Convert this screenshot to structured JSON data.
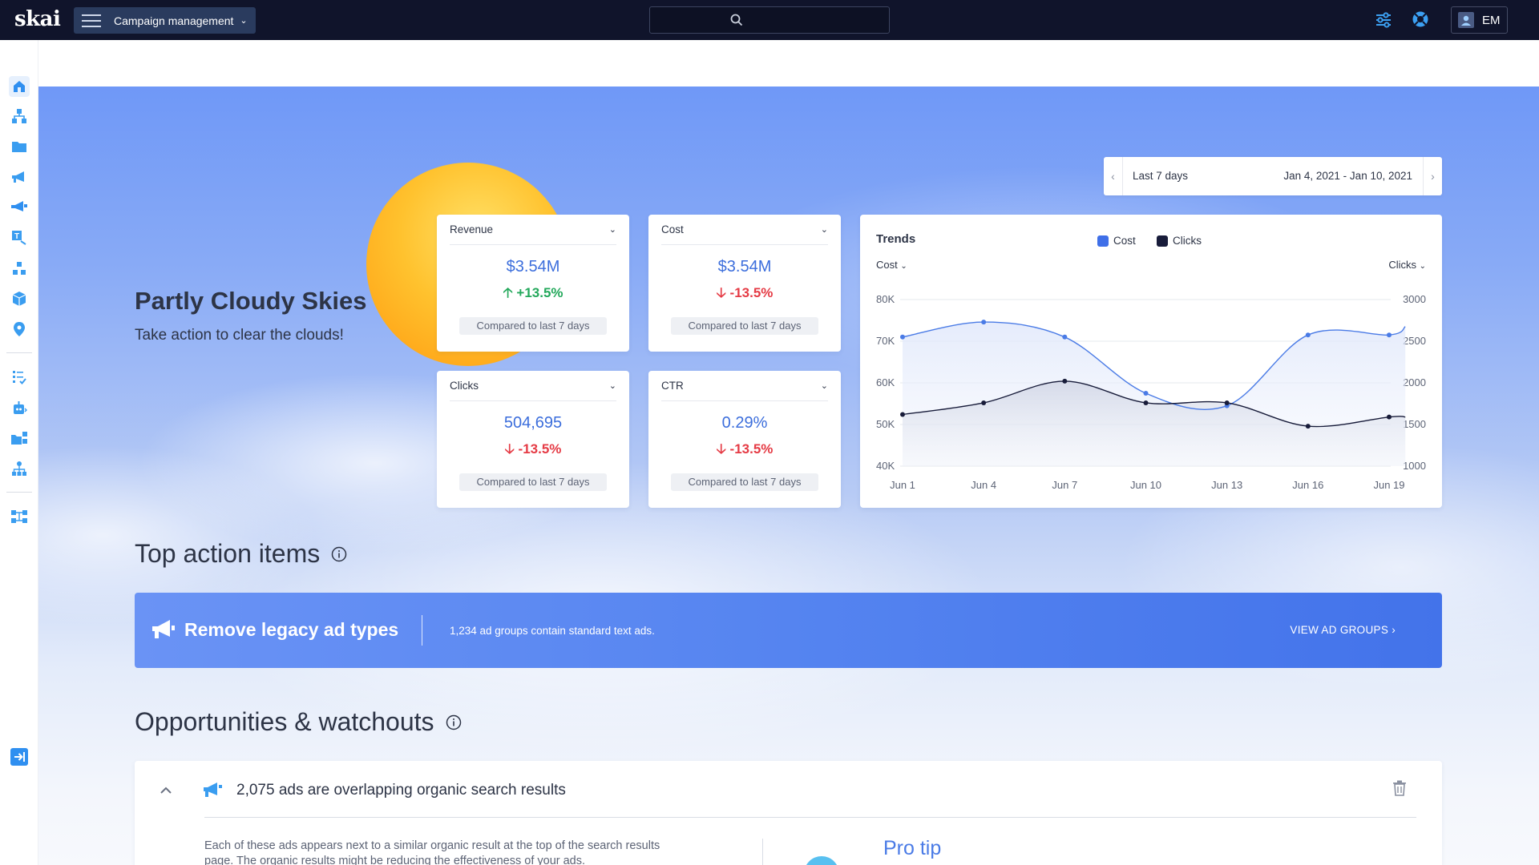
{
  "topbar": {
    "logo": "skai",
    "app_menu_label": "Campaign management",
    "user_initials": "EM"
  },
  "hero": {
    "title": "Partly Cloudy Skies",
    "subtitle": "Take action to clear the clouds!"
  },
  "date_picker": {
    "range_label": "Last 7 days",
    "dates": "Jan 4, 2021 - Jan 10, 2021"
  },
  "kpis": [
    {
      "label": "Revenue",
      "value": "$3.54M",
      "delta": "+13.5%",
      "direction": "up",
      "compare": "Compared to last 7 days"
    },
    {
      "label": "Cost",
      "value": "$3.54M",
      "delta": "-13.5%",
      "direction": "down",
      "compare": "Compared to last 7 days"
    },
    {
      "label": "Clicks",
      "value": "504,695",
      "delta": "-13.5%",
      "direction": "down",
      "compare": "Compared to last 7 days"
    },
    {
      "label": "CTR",
      "value": "0.29%",
      "delta": "-13.5%",
      "direction": "down",
      "compare": "Compared to last 7 days"
    }
  ],
  "trends": {
    "title": "Trends",
    "left_selector": "Cost",
    "right_selector": "Clicks",
    "legend": [
      {
        "name": "Cost",
        "color": "#3f6fe8"
      },
      {
        "name": "Clicks",
        "color": "#181c3a"
      }
    ]
  },
  "chart_data": {
    "type": "line",
    "x": [
      "Jun 1",
      "Jun 4",
      "Jun 7",
      "Jun 10",
      "Jun 13",
      "Jun 16",
      "Jun 19"
    ],
    "y_left_ticks": [
      "80K",
      "70K",
      "60K",
      "50K",
      "40K"
    ],
    "y_left_range": [
      40000,
      80000
    ],
    "y_right_ticks": [
      "3000",
      "2500",
      "2000",
      "1500",
      "1000"
    ],
    "y_right_range": [
      1000,
      3000
    ],
    "series": [
      {
        "name": "Cost",
        "axis": "left",
        "color": "#4a7be6",
        "x": [
          1,
          4,
          7,
          10,
          13,
          16,
          19,
          19.6
        ],
        "values": [
          71000,
          74600,
          71000,
          57500,
          54500,
          71500,
          71500,
          73500
        ]
      },
      {
        "name": "Clicks",
        "axis": "right",
        "color": "#181c3a",
        "x": [
          1,
          4,
          7,
          10,
          13,
          16,
          19,
          19.6
        ],
        "values": [
          1620,
          1760,
          2020,
          1760,
          1760,
          1480,
          1590,
          1590
        ]
      }
    ],
    "grid": true,
    "legend_position": "top-center"
  },
  "top_actions": {
    "title": "Top action items",
    "item": {
      "title": "Remove legacy ad types",
      "description": "1,234 ad groups contain standard text ads.",
      "link": "VIEW AD GROUPS"
    }
  },
  "opportunities": {
    "title": "Opportunities & watchouts",
    "item": {
      "title": "2,075 ads are overlapping organic search results",
      "body": "Each of these ads appears next to a similar organic result at the top of the search results page. The organic results might be reducing the effectiveness of your ads.",
      "tip_title": "Pro tip"
    }
  },
  "colors": {
    "topbar": "#10142b",
    "accent": "#3c6edc",
    "up": "#23a85b",
    "down": "#e53b45",
    "nav_icon": "#3a9df0"
  }
}
